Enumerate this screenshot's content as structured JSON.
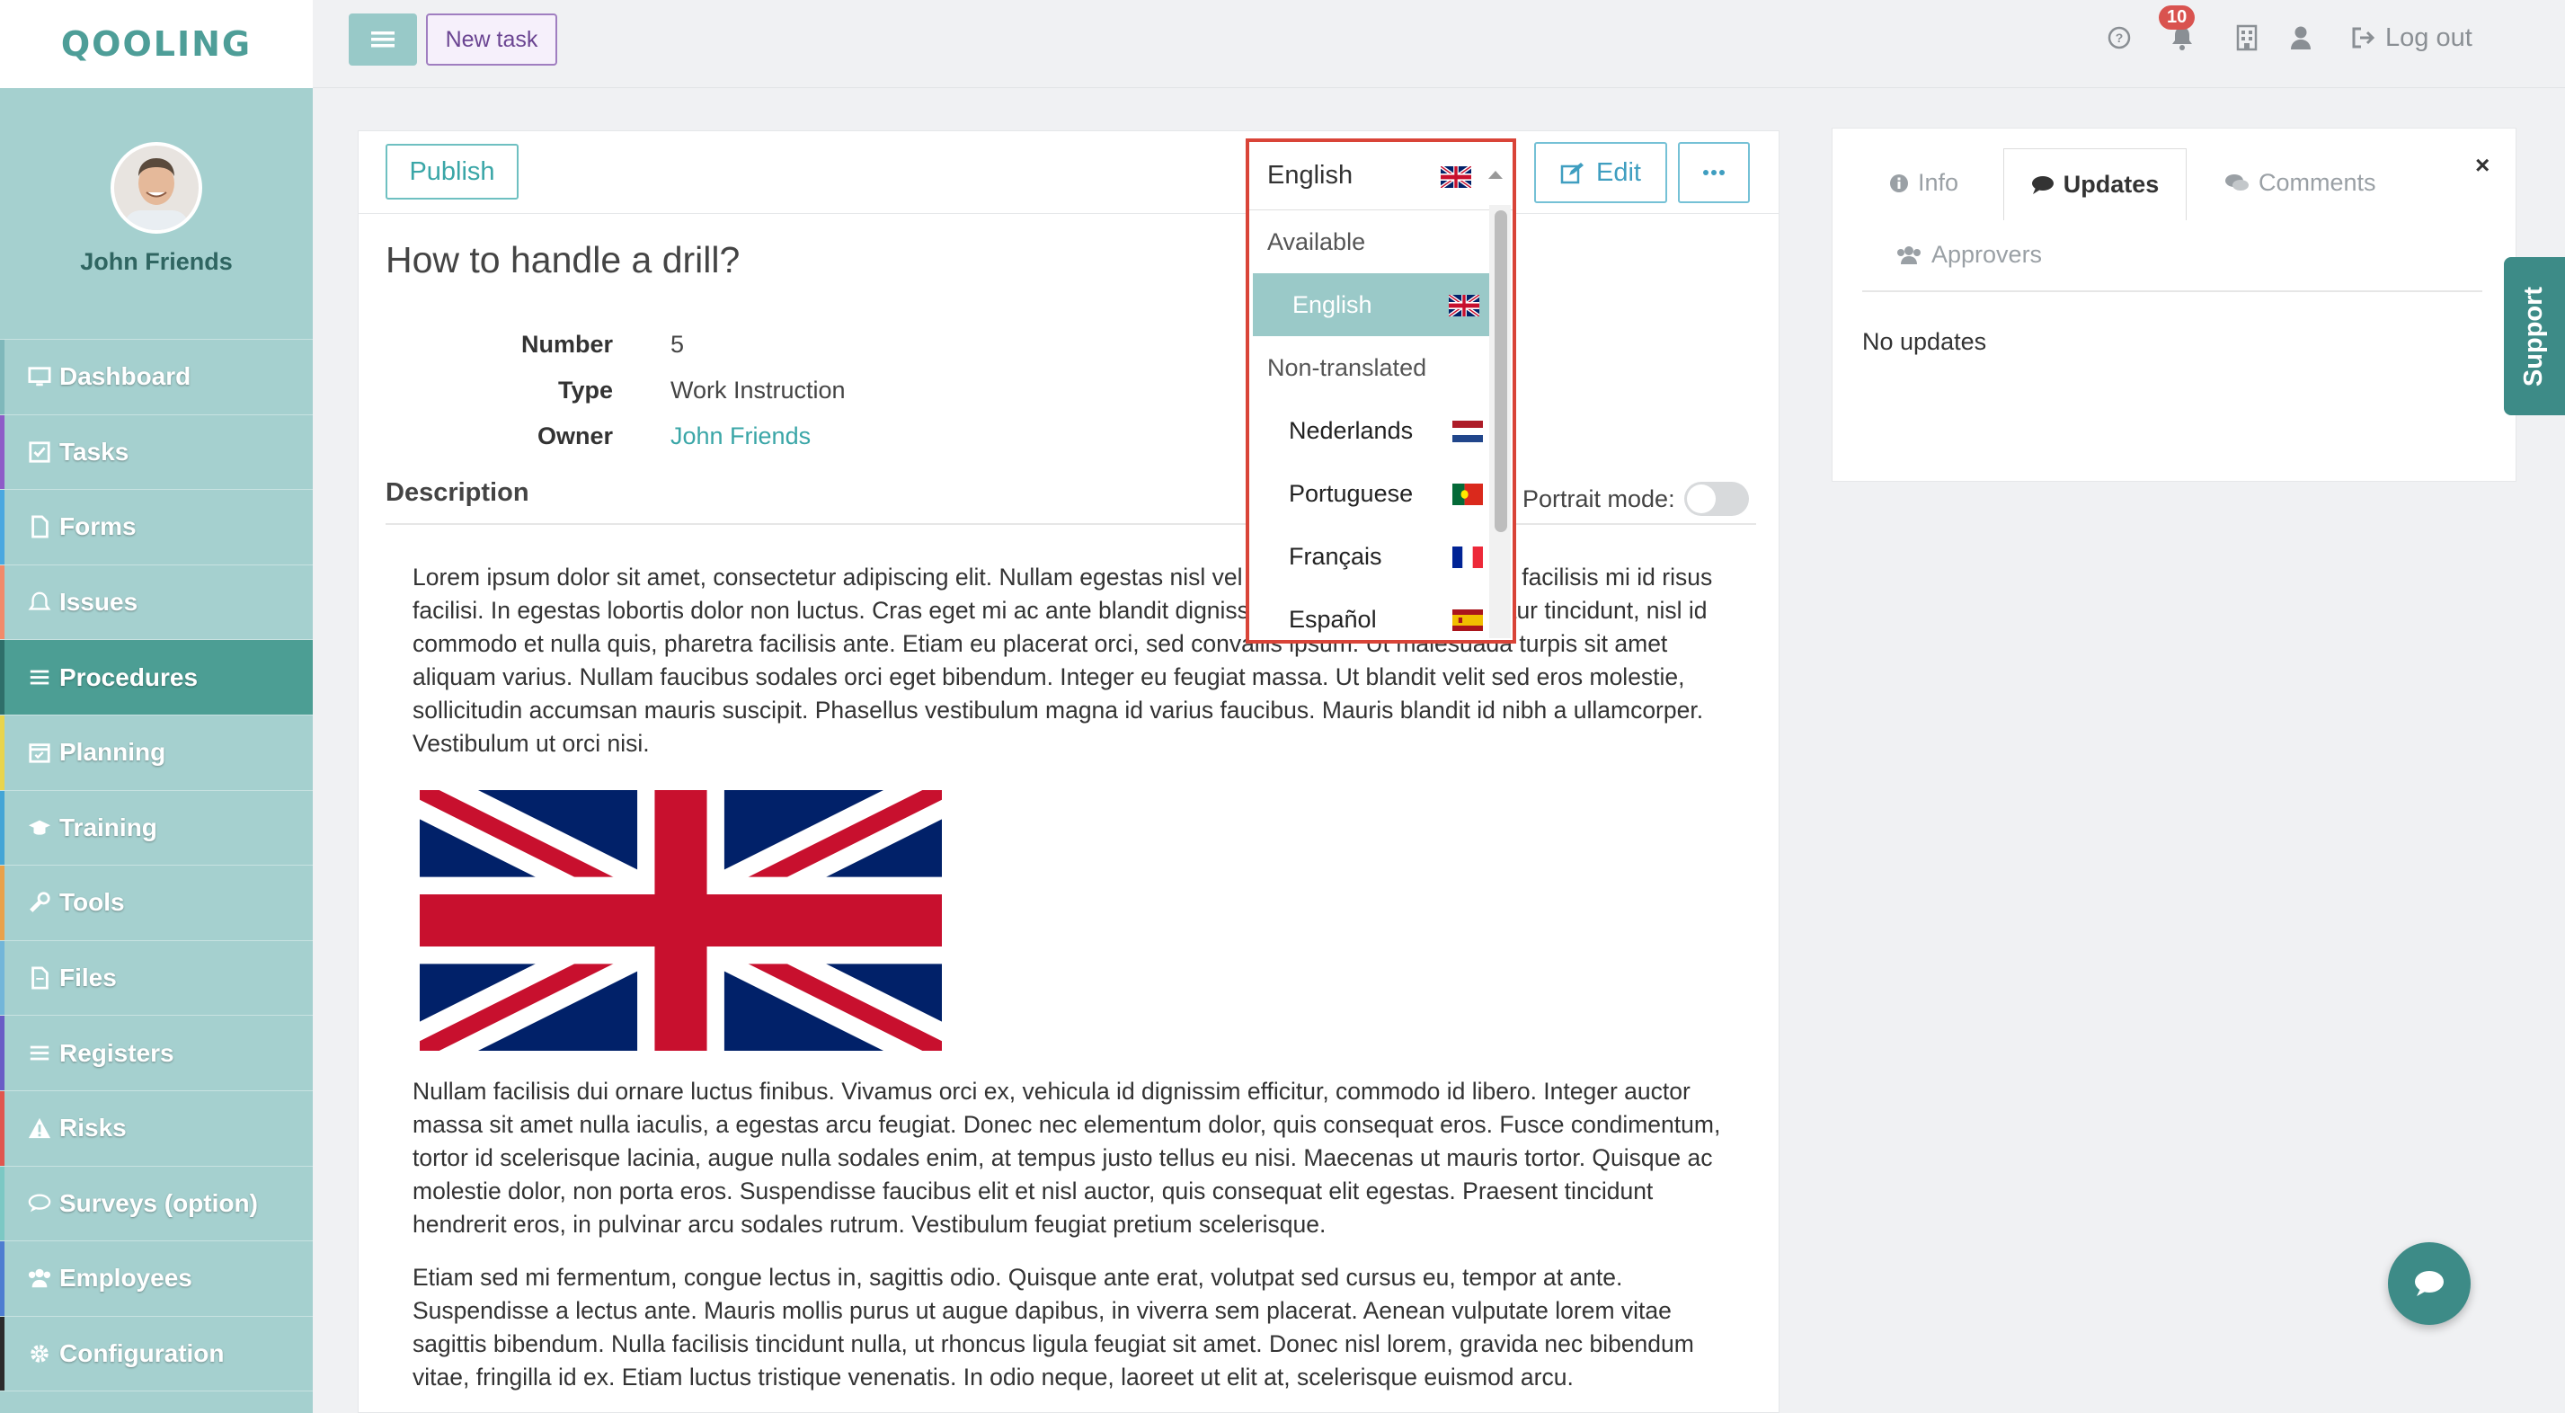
{
  "app": {
    "logo": "QOOLING"
  },
  "topbar": {
    "new_task_label": "New task",
    "notification_count": "10",
    "logout_label": "Log out",
    "icons": [
      "menu-icon",
      "help-icon",
      "bell-icon",
      "building-icon",
      "user-icon",
      "logout-icon"
    ]
  },
  "sidebar": {
    "user_name": "John Friends",
    "items": [
      {
        "label": "Dashboard",
        "icon": "monitor-icon",
        "accent": "#7fb8bb"
      },
      {
        "label": "Tasks",
        "icon": "checkbox-icon",
        "accent": "#8e5cc8"
      },
      {
        "label": "Forms",
        "icon": "document-icon",
        "accent": "#4aa8e0"
      },
      {
        "label": "Issues",
        "icon": "bell-icon",
        "accent": "#f28a6a"
      },
      {
        "label": "Procedures",
        "icon": "list-icon",
        "accent": "#2f6f6a"
      },
      {
        "label": "Planning",
        "icon": "calendar-icon",
        "accent": "#e8d44d"
      },
      {
        "label": "Training",
        "icon": "graduation-icon",
        "accent": "#44a5d6"
      },
      {
        "label": "Tools",
        "icon": "wrench-icon",
        "accent": "#e9a14a"
      },
      {
        "label": "Files",
        "icon": "file-icon",
        "accent": "#73b6d9"
      },
      {
        "label": "Registers",
        "icon": "list-icon",
        "accent": "#6a5cc6"
      },
      {
        "label": "Risks",
        "icon": "warning-icon",
        "accent": "#e0564f"
      },
      {
        "label": "Surveys (option)",
        "icon": "speech-icon",
        "accent": "#7cc8c4"
      },
      {
        "label": "Employees",
        "icon": "users-icon",
        "accent": "#4e7dd1"
      },
      {
        "label": "Configuration",
        "icon": "gear-icon",
        "accent": "#2b2b2b"
      }
    ]
  },
  "toolbar": {
    "publish_label": "Publish",
    "language_selected": "English",
    "edit_label": "Edit",
    "more_label": "···"
  },
  "document": {
    "title": "How to handle a drill?",
    "meta": [
      {
        "label": "Number",
        "value": "5"
      },
      {
        "label": "Type",
        "value": "Work Instruction"
      },
      {
        "label": "Owner",
        "value": "John Friends"
      }
    ],
    "description_heading": "Description",
    "portrait_label": "Portrait mode:",
    "paragraphs": [
      "Lorem ipsum dolor sit amet, consectetur adipiscing elit. Nullam egestas nisl vel viverra facilisis. Curabitur facilisis mi id risus facilisi. In egestas lobortis dolor non luctus. Cras eget mi ac ante blandit dignissim ut luctus nulla. Curabitur tincidunt, nisl id commodo et nulla quis, pharetra facilisis ante. Etiam eu placerat orci, sed convallis ipsum. Ut malesuada turpis sit amet aliquam varius. Nullam faucibus sodales orci eget bibendum. Integer eu feugiat massa. Ut blandit velit sed eros molestie, sollicitudin accumsan mauris suscipit. Phasellus vestibulum magna id varius faucibus. Mauris blandit id nibh a ullamcorper. Vestibulum ut orci nisi.",
      "Nullam facilisis dui ornare luctus finibus. Vivamus orci ex, vehicula id dignissim efficitur, commodo id libero. Integer auctor massa sit amet nulla iaculis, a egestas arcu feugiat. Donec nec elementum dolor, quis consequat eros. Fusce condimentum, tortor id scelerisque lacinia, augue nulla sodales enim, at tempus justo tellus eu nisi. Maecenas ut mauris tortor. Quisque ac molestie dolor, non porta eros. Suspendisse faucibus elit et nisl auctor, quis consequat elit egestas. Praesent tincidunt hendrerit eros, in pulvinar arcu sodales rutrum. Vestibulum feugiat pretium scelerisque.",
      "Etiam sed mi fermentum, congue lectus in, sagittis odio. Quisque ante erat, volutpat sed cursus eu, tempor at ante. Suspendisse a lectus ante. Mauris mollis purus ut augue dapibus, in viverra sem placerat. Aenean vulputate lorem vitae sagittis bibendum. Nulla facilisis tincidunt nulla, ut rhoncus ligula feugiat sit amet. Donec nisl lorem, gravida nec bibendum vitae, fringilla id ex. Etiam luctus tristique venenatis. In odio neque, laoreet ut elit at, scelerisque euismod arcu."
    ]
  },
  "language_dropdown": {
    "selected": "English",
    "groups": [
      {
        "label": "Available",
        "options": [
          {
            "label": "English",
            "flag": "uk-flag-icon",
            "selected": true
          }
        ]
      },
      {
        "label": "Non-translated",
        "options": [
          {
            "label": "Nederlands",
            "flag": "netherlands-flag-icon"
          },
          {
            "label": "Portuguese",
            "flag": "portugal-flag-icon"
          },
          {
            "label": "Français",
            "flag": "france-flag-icon"
          },
          {
            "label": "Español",
            "flag": "spain-flag-icon"
          }
        ]
      }
    ]
  },
  "right_panel": {
    "tabs": [
      {
        "label": "Info",
        "icon": "info-icon"
      },
      {
        "label": "Updates",
        "icon": "comment-icon",
        "active": true
      },
      {
        "label": "Comments",
        "icon": "comments-icon"
      },
      {
        "label": "Approvers",
        "icon": "users-icon"
      }
    ],
    "empty_text": "No updates",
    "close": "×"
  },
  "support_label": "Support",
  "colors": {
    "teal": "#3d8b87",
    "sidebar": "#a5d0cf",
    "active_nav": "#4c9e94",
    "highlight_border": "#d94438"
  }
}
